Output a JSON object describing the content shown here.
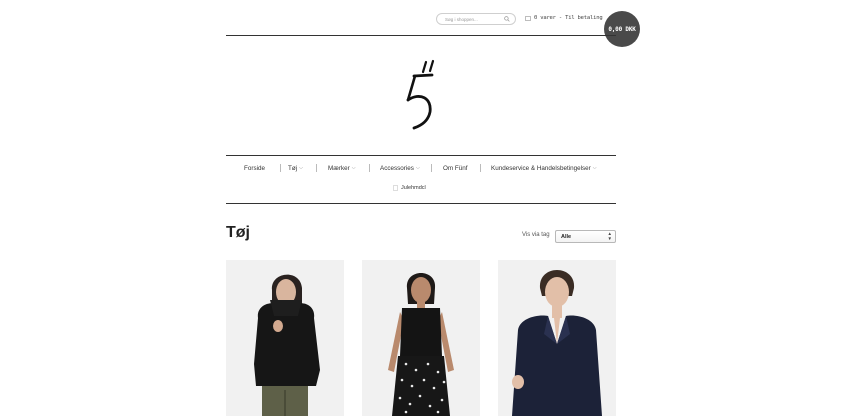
{
  "header": {
    "search_placeholder": "Søg i shoppen...",
    "cart_text": "0 varer - Til betaling",
    "cart_total": "0,00 DKK"
  },
  "logo": {
    "glyph": "5"
  },
  "nav": {
    "items": [
      {
        "label": "Forside",
        "has_dropdown": false
      },
      {
        "label": "Tøj",
        "has_dropdown": true
      },
      {
        "label": "Mærker",
        "has_dropdown": true
      },
      {
        "label": "Accessories",
        "has_dropdown": true
      },
      {
        "label": "Om Fünf",
        "has_dropdown": false
      },
      {
        "label": "Kundeservice & Handelsbetingelser",
        "has_dropdown": true
      }
    ],
    "sub_item": "Julehmdcl"
  },
  "main": {
    "title": "Tøj",
    "sort_label": "Vis via tag",
    "sort_value": "Alle"
  },
  "products": [
    {
      "outfit": "black-high-neck-coat"
    },
    {
      "outfit": "black-top-polka-skirt"
    },
    {
      "outfit": "navy-blazer"
    }
  ],
  "colors": {
    "badge_bg": "#4a4a4a",
    "rule": "#333333"
  }
}
